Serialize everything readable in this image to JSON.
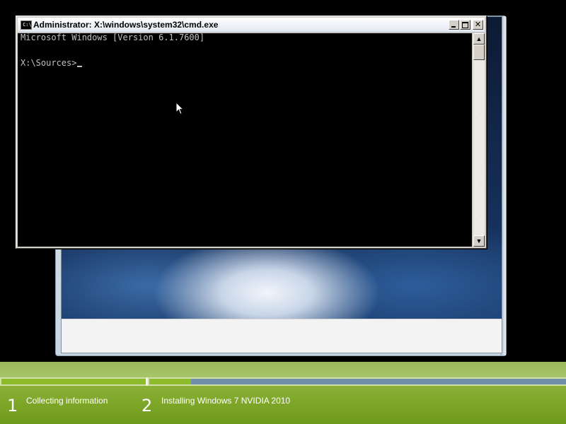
{
  "cmd": {
    "title": "Administrator: X:\\windows\\system32\\cmd.exe",
    "icon": "C:\\",
    "lines": [
      "Microsoft Windows [Version 6.1.7600]",
      "X:\\Sources>"
    ],
    "close_glyph": "✕"
  },
  "setup": {
    "steps": [
      {
        "number": "1",
        "label": "Collecting information",
        "progress": 1.0
      },
      {
        "number": "2",
        "label": "Installing Windows 7 NVIDIA 2010",
        "progress": 0.1
      }
    ]
  },
  "icons": {
    "cursor": "arrow-cursor-icon",
    "scroll_up": "▲",
    "scroll_down": "▼"
  },
  "colors": {
    "console_bg": "#000000",
    "console_text": "#c0c0c0",
    "progress_green": "#8dbb2c",
    "progress_pending": "#6f8fa9"
  }
}
